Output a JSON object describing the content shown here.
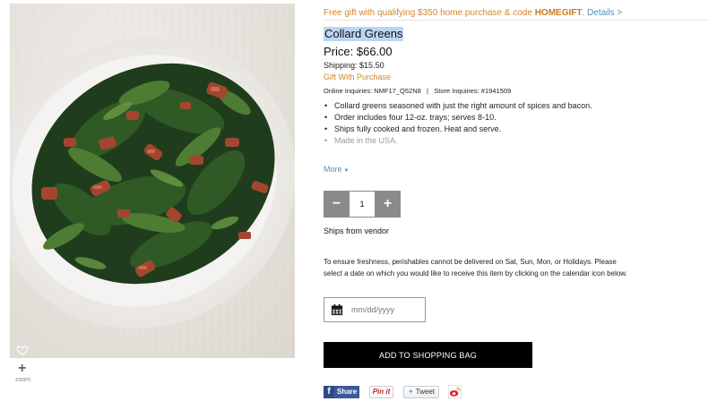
{
  "promo": {
    "text": "Free gift with qualifying $350 home purchase & code ",
    "code": "HOMEGIFT",
    "period": ".",
    "details_link": "Details >"
  },
  "product": {
    "title": "Collard Greens",
    "price_label": "Price:",
    "price": "$66.00",
    "shipping_label": "Shipping:",
    "shipping": "$15.50",
    "gift_link": "Gift With Purchase",
    "inquiries": "Online Inquiries: NMF17_Q52N8   |   Store Inquiries: #1941509",
    "bullets": [
      "Collard greens seasoned with just the right amount of spices and bacon.",
      "Order includes four 12-oz. trays; serves 8-10.",
      "Ships fully cooked and frozen. Heat and serve.",
      "Made in the USA."
    ],
    "more_link": "More"
  },
  "quantity": {
    "decrement": "−",
    "value": "1",
    "increment": "+"
  },
  "shipping_note": "Ships from vendor",
  "freshness_note": "To ensure freshness, perishables cannot be delivered on Sat, Sun, Mon, or Holidays. Please select a date on which you would like to receive this item by clicking on the calendar icon below.",
  "date_field": {
    "placeholder": "mm/dd/yyyy"
  },
  "add_to_bag": "ADD TO SHOPPING BAG",
  "image_controls": {
    "zoom_label": "zoom",
    "zoom_icon": "+"
  },
  "share": {
    "facebook": "Share",
    "pinterest": "Pin it",
    "twitter": "Tweet"
  },
  "colors": {
    "promo_orange": "#d4862a",
    "link_blue": "#4a8fc4",
    "title_highlight": "#bcd6f1",
    "stepper_gray": "#8a8a8a",
    "cta_black": "#000000"
  },
  "icons": [
    "heart-icon",
    "zoom-plus-icon",
    "calendar-icon",
    "facebook-icon",
    "twitter-bird-icon",
    "weibo-icon",
    "more-caret-icon"
  ]
}
